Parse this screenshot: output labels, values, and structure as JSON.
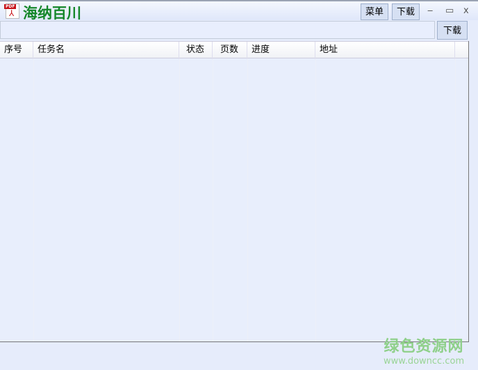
{
  "app": {
    "title": "海纳百川",
    "logo_text": "PDF"
  },
  "titlebar": {
    "menu_label": "菜单",
    "download_label": "下载",
    "minimize": "‒",
    "maximize": "▭",
    "close": "x"
  },
  "url_input": {
    "value": "",
    "placeholder": ""
  },
  "download_button": "下载",
  "table": {
    "columns": [
      "序号",
      "任务名",
      "状态",
      "页数",
      "进度",
      "地址"
    ],
    "rows": []
  },
  "watermark": {
    "name": "绿色资源网",
    "url": "www.downcc.com"
  }
}
